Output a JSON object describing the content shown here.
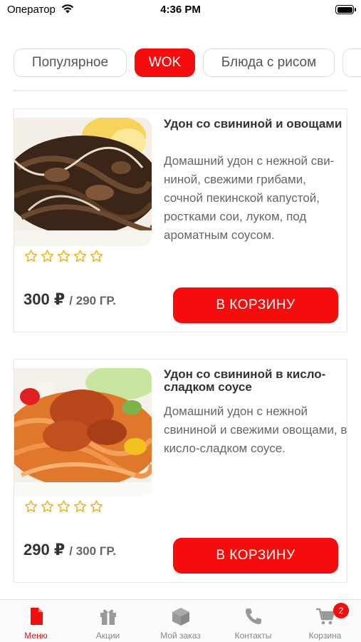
{
  "status_bar": {
    "carrier": "Оператор",
    "time": "4:36 PM"
  },
  "tabs": [
    {
      "label": "Популярное",
      "active": false
    },
    {
      "label": "WOK",
      "active": true
    },
    {
      "label": "Блюда с рисом",
      "active": false
    }
  ],
  "products": [
    {
      "title": "Удон со свининой и овощами",
      "description": "Домашний удон с нежной сви- ниной, свежими грибами, сочной пекинской капустой, ростками сои, луком, под ароматным соусом.",
      "rating": 0,
      "price": "300 ₽",
      "weight": "/ 290 ГР.",
      "button": "В КОРЗИНУ"
    },
    {
      "title": "Удон со свининой в кисло-сладком соусе",
      "description": "Домашний удон с нежной свининой и свежими овощами, в кисло-сладком соусе.",
      "rating": 0,
      "price": "290 ₽",
      "weight": "/ 300 ГР.",
      "button": "В КОРЗИНУ"
    }
  ],
  "tabbar": [
    {
      "label": "Меню",
      "icon": "document-icon",
      "active": true
    },
    {
      "label": "Акции",
      "icon": "gift-icon",
      "active": false
    },
    {
      "label": "Мой заказ",
      "icon": "box-icon",
      "active": false
    },
    {
      "label": "Контакты",
      "icon": "phone-icon",
      "active": false
    },
    {
      "label": "Корзина",
      "icon": "cart-icon",
      "active": false,
      "badge": "2"
    }
  ],
  "colors": {
    "accent": "#f50c0c",
    "star": "#f3b21b"
  }
}
